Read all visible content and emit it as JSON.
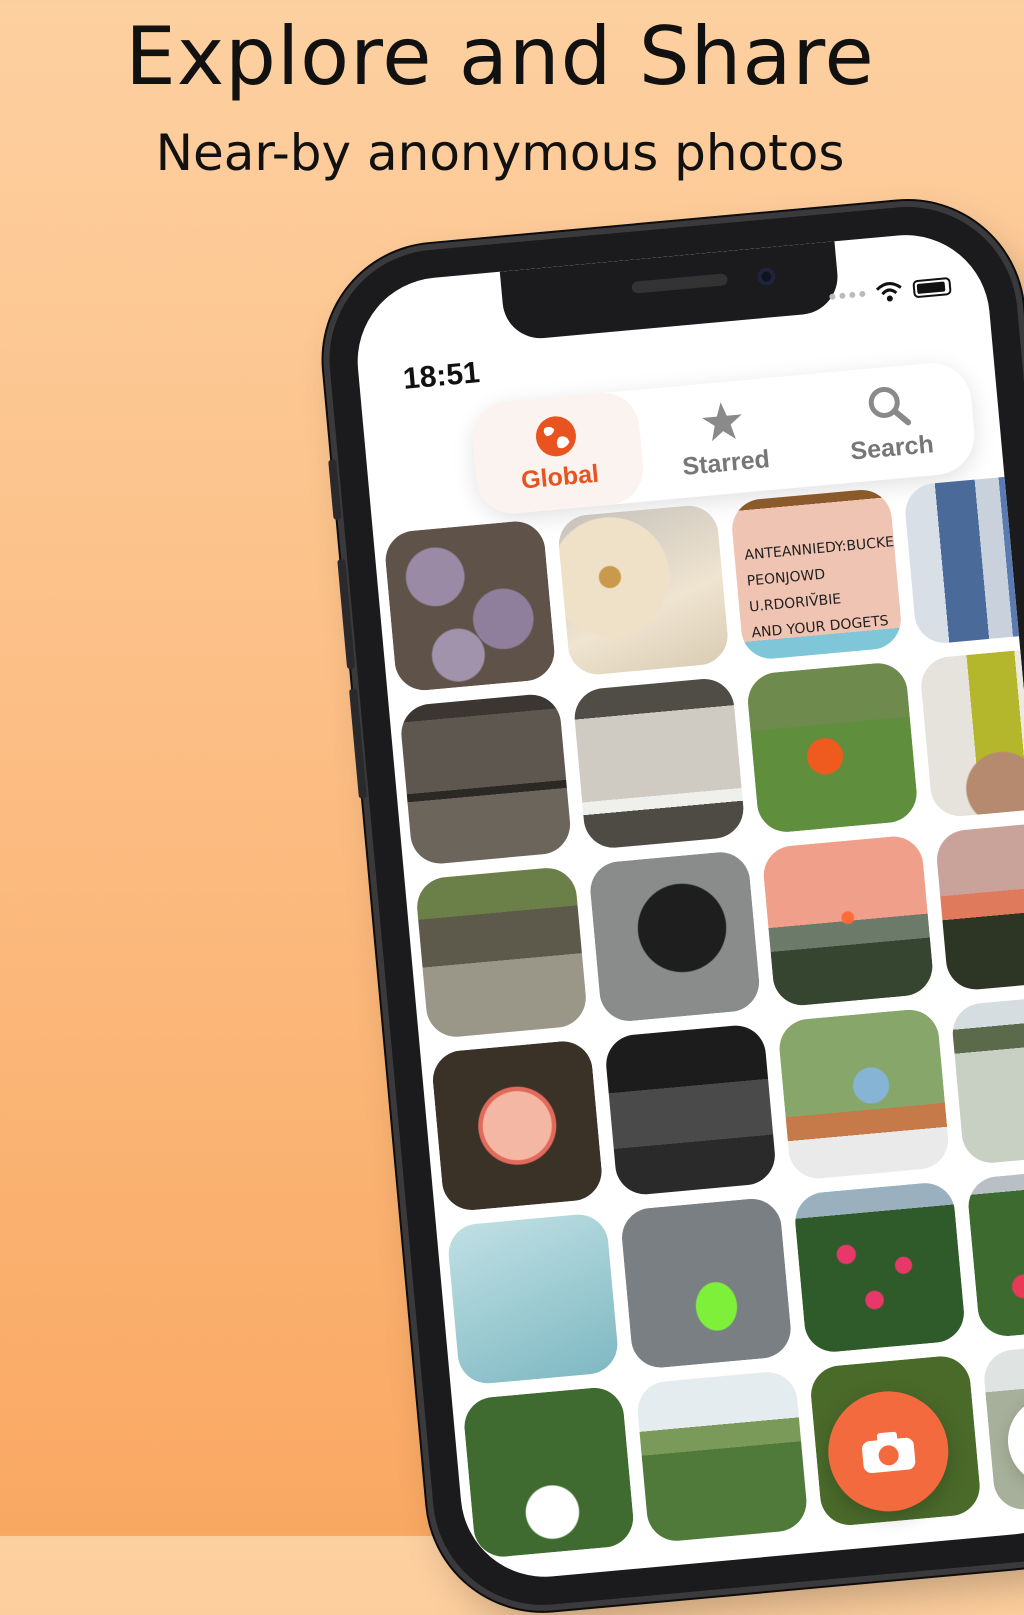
{
  "headline": "Explore and Share",
  "subheadline": "Near-by  anonymous photos",
  "status_bar": {
    "time": "18:51"
  },
  "tabs": [
    {
      "label": "Global",
      "icon": "globe-icon",
      "active": true
    },
    {
      "label": "Starred",
      "icon": "star-icon",
      "active": false
    },
    {
      "label": "Search",
      "icon": "search-icon",
      "active": false
    }
  ],
  "sign_photo_text": "ANTEANNIEDY:BUCKER\nPEONJOWD U.RDORIV̆BIE\nAND YOUR DOGETS",
  "buttons": {
    "camera": "camera-icon",
    "people": "people-icon"
  },
  "colors": {
    "accent": "#e8531f",
    "camera_button": "#f26a3d",
    "background_top": "#fdd0a0",
    "background_bottom": "#f9a862"
  }
}
